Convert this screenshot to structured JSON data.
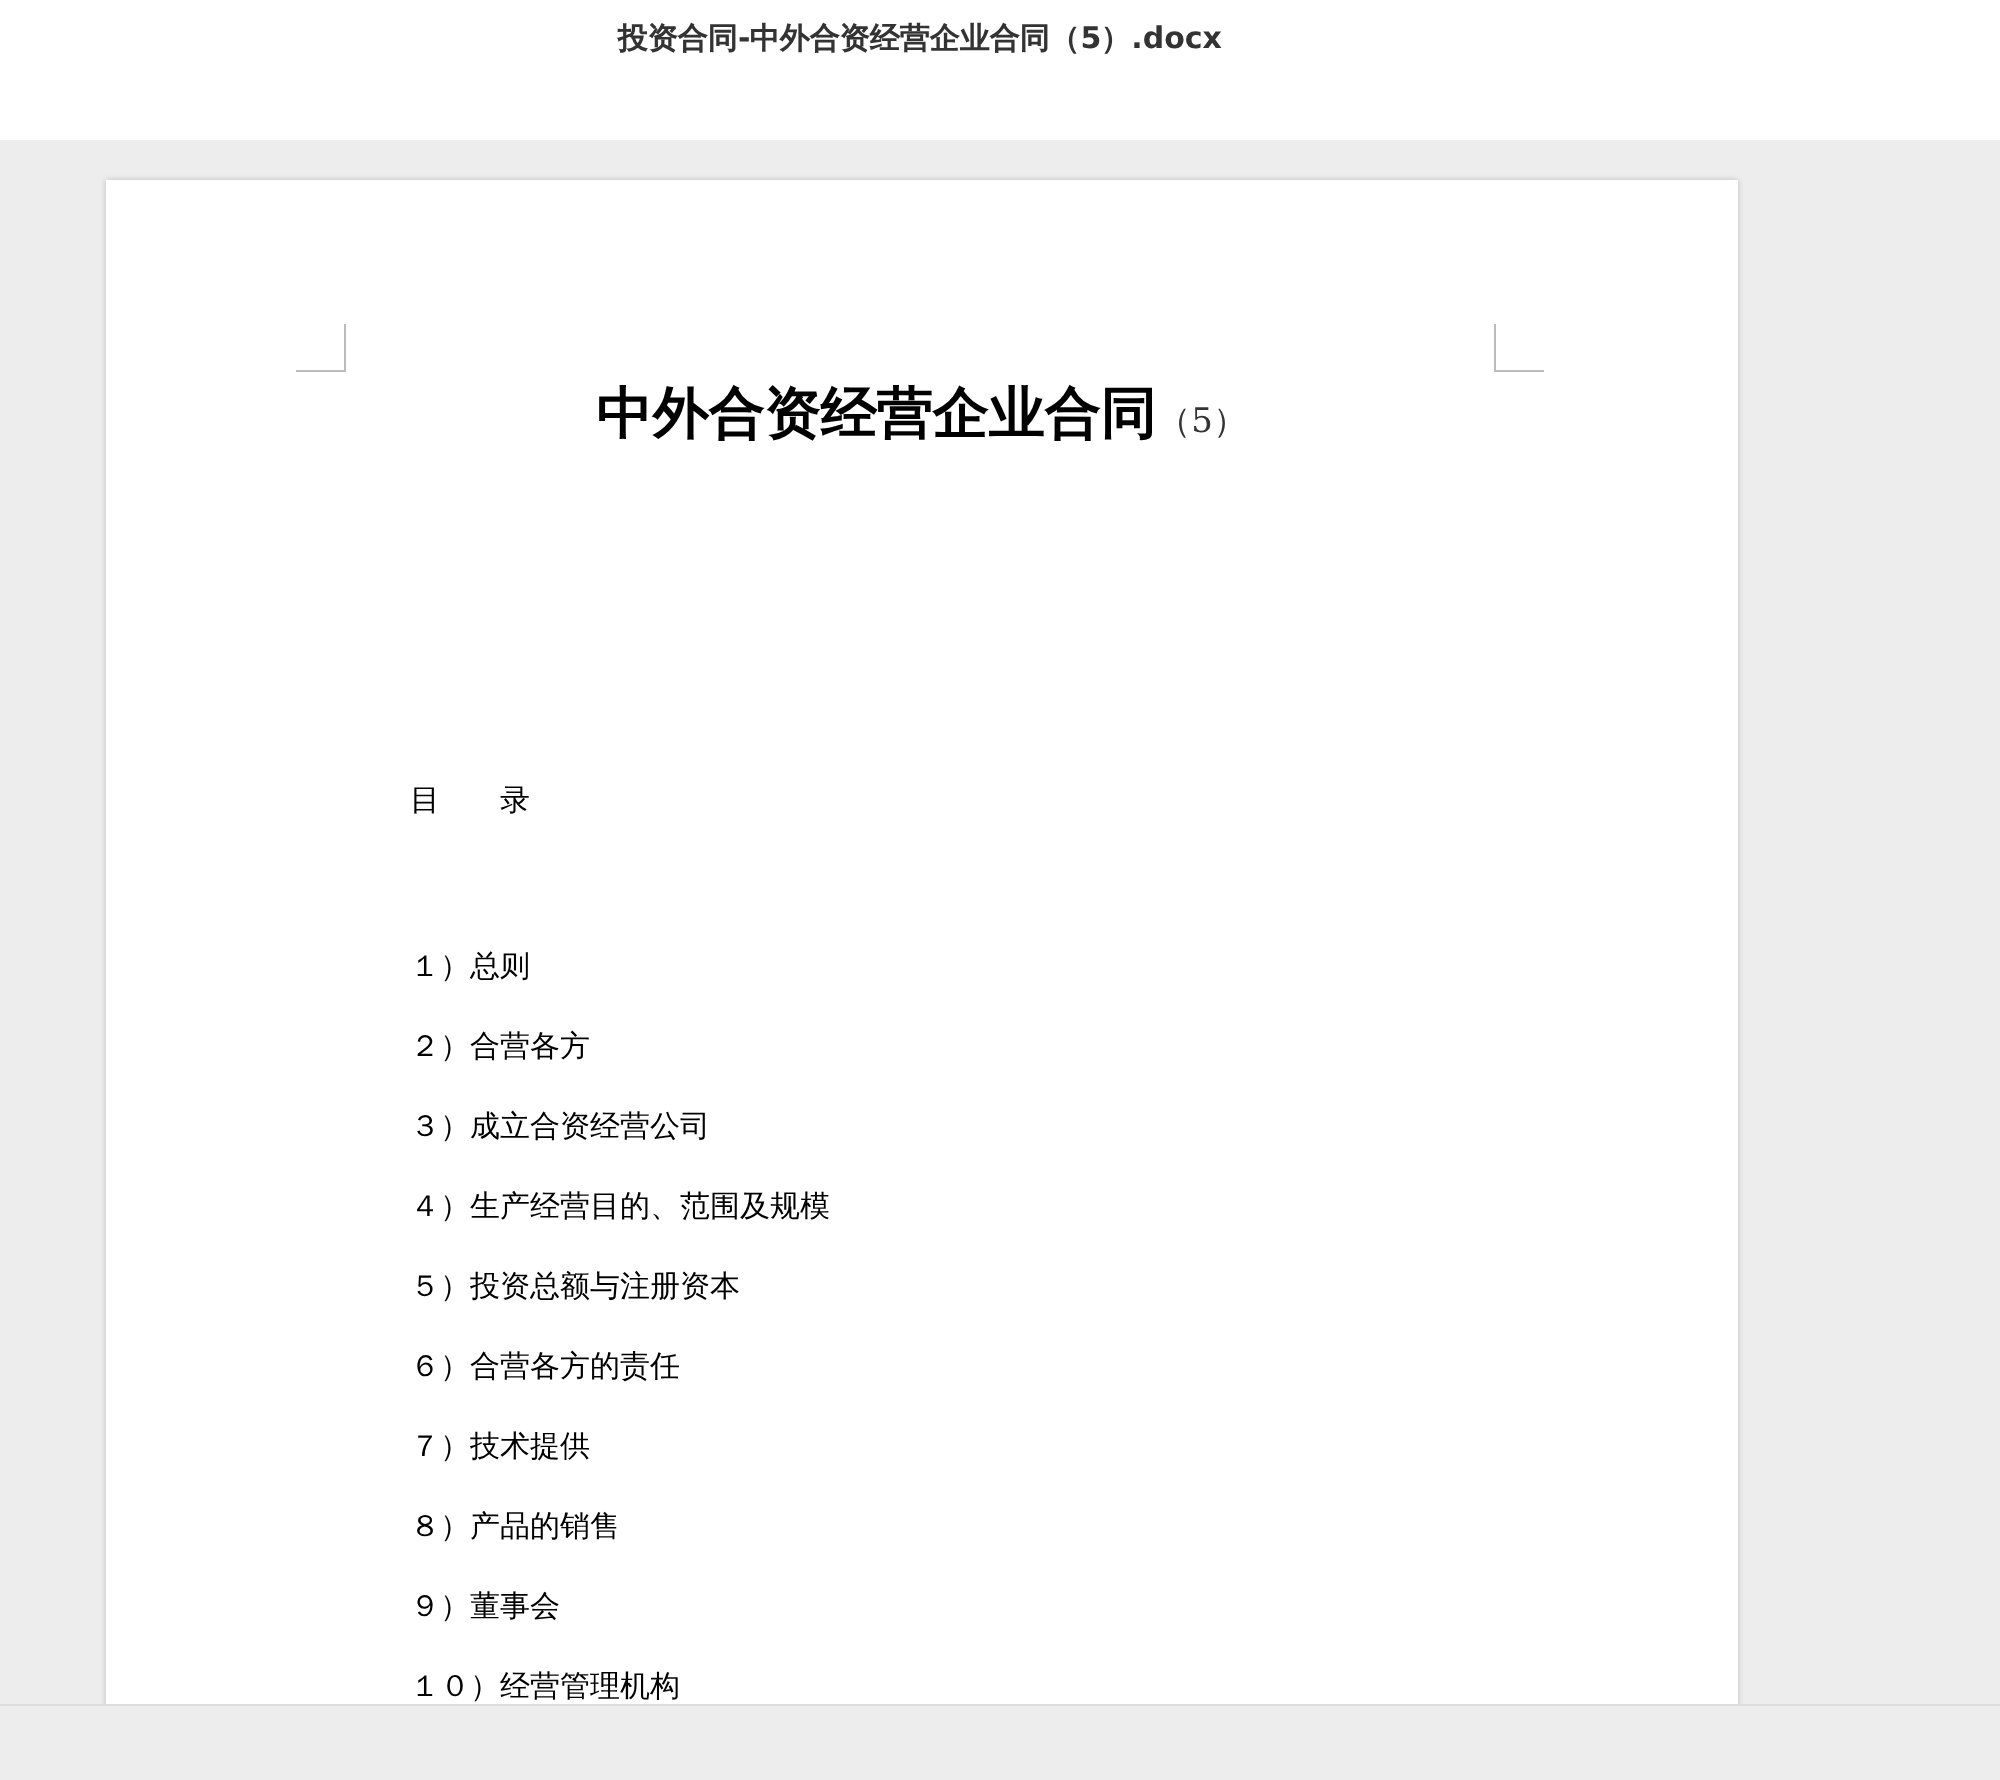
{
  "window": {
    "title": "投资合同-中外合资经营企业合同（5）.docx"
  },
  "document": {
    "title": "中外合资经营企业合同",
    "title_suffix": "（5）",
    "toc_heading": "目　　录",
    "toc_items": [
      "１）总则",
      "２）合营各方",
      "３）成立合资经营公司",
      "４）生产经营目的、范围及规模",
      "５）投资总额与注册资本",
      "６）合营各方的责任",
      "７）技术提供",
      "８）产品的销售",
      "９）董事会",
      "１０）经营管理机构"
    ]
  }
}
